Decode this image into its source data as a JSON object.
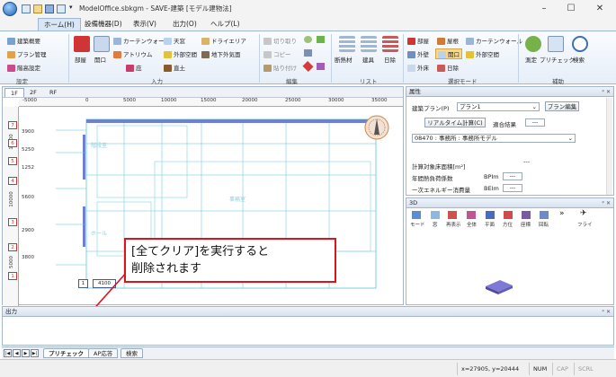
{
  "window": {
    "title": "ModelOffice.sbkgm - SAVE-建築 [モデル建物法]",
    "minimize": "–",
    "maximize": "☐",
    "close": "✕"
  },
  "ribbon_tabs": [
    "ホーム(H)",
    "設備機器(D)",
    "表示(V)",
    "出力(O)",
    "ヘルプ(L)"
  ],
  "ribbon": {
    "group1": {
      "label": "設定",
      "items": [
        "建築概要",
        "プラン管理",
        "階高設定"
      ]
    },
    "group2": {
      "label": "入力",
      "big_items": [
        "部屋",
        "開口"
      ],
      "items": [
        "カーテンウォール",
        "天窓",
        "ドライエリア",
        "アトリウム",
        "外部空間",
        "地下外気面",
        "庇",
        "直土"
      ]
    },
    "group3": {
      "label": "編集",
      "items": [
        "切り取り",
        "コピー",
        "貼り付け"
      ]
    },
    "group4": {
      "label": "リスト",
      "items": [
        "断熱材",
        "建具",
        "日除"
      ]
    },
    "group5": {
      "label": "選択モード",
      "items": [
        "部屋",
        "屋根",
        "カーテンウォール",
        "外壁",
        "開口",
        "外部空間",
        "外床",
        "日除"
      ]
    },
    "group6": {
      "label": "補助",
      "items": [
        "測定",
        "プリチェック",
        "検索"
      ]
    }
  },
  "drawing": {
    "floor_tabs": [
      "1F",
      "2F",
      "RF"
    ],
    "active_floor": "1F",
    "ruler_top": [
      "-5000",
      "0",
      "5000",
      "10000",
      "15000",
      "20000",
      "25000",
      "30000",
      "35000"
    ],
    "ruler_left": [
      "13000",
      "10000",
      "5000"
    ],
    "levels": [
      {
        "num": "7",
        "val": "3900"
      },
      {
        "num": "6",
        "val": "5250"
      },
      {
        "num": "5",
        "val": "1252"
      },
      {
        "num": "4",
        "val": "5600"
      },
      {
        "num": "3",
        "val": "2900"
      },
      {
        "num": "2",
        "val": "3800"
      },
      {
        "num": "1",
        "val": ""
      }
    ],
    "room_labels": [
      "事務室",
      "ホール",
      "廊下",
      "階段室"
    ],
    "bottom_box_label": "4100"
  },
  "callout": {
    "line1": "[全てクリア]を実行すると",
    "line2": "削除されます"
  },
  "properties": {
    "title": "属性",
    "plan_label": "建築プラン(P)",
    "plan_value": "プラン1",
    "plan_edit": "プラン編集",
    "realtime_calc": "リアルタイム計算(C)",
    "judge_label": "適合結果",
    "judge_value": "---",
    "building_type": "08470 : 事務所 : 事務所モデル",
    "area_label": "計算対象床面積[m²]",
    "area_value": "---",
    "pal_label": "年間熱負荷係数",
    "pal_unit": "BPIm",
    "pal_value": "---",
    "energy_label": "一次エネルギー消費量",
    "energy_unit": "BEIm",
    "energy_value": "---"
  },
  "panel_3d": {
    "title": "3D",
    "tools": [
      "モード",
      "窓",
      "再表示",
      "全体",
      "平面",
      "方位",
      "座標",
      "回転",
      "フライ"
    ]
  },
  "output": {
    "title": "出力"
  },
  "bottom_tabs": {
    "nav": [
      "|◀",
      "◀",
      "▶",
      "▶|"
    ],
    "tabs": [
      "プリチェック",
      "AP応答",
      "検索"
    ],
    "active": "プリチェック"
  },
  "status": {
    "coords": "x=27905, y=20444",
    "num": "NUM",
    "cap": "CAP",
    "scrl": "SCRL"
  },
  "colors": {
    "accent_red": "#d9141e",
    "ribbon_blue": "#d8e6f5",
    "draw_cyan": "#59c6d6",
    "wall_blue": "#6f7fd6"
  }
}
